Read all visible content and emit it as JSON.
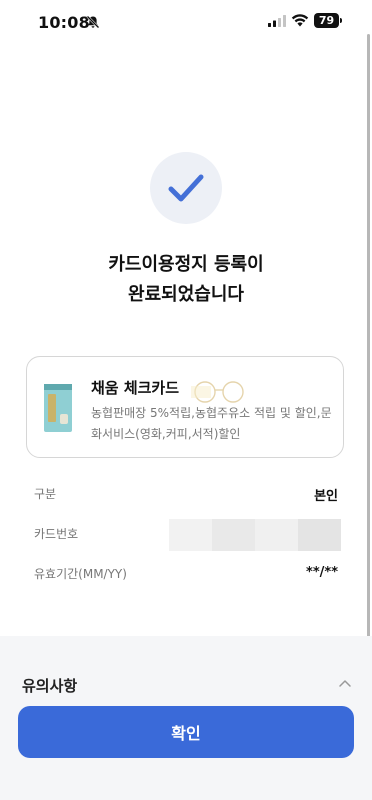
{
  "status_bar": {
    "time": "10:08",
    "battery": "79",
    "icons": [
      "bell-off-icon",
      "signal-icon",
      "wifi-icon",
      "battery-icon"
    ]
  },
  "result": {
    "icon": "check-icon",
    "title_line1": "카드이용정지 등록이",
    "title_line2": "완료되었습니다"
  },
  "card": {
    "name": "채움 체크카드",
    "description": "농협판매장 5%적립,농협주유소 적립 및 할인,문화서비스(영화,커피,서적)할인"
  },
  "info": {
    "type_label": "구분",
    "type_value": "본인",
    "card_number_label": "카드번호",
    "card_number_masked": [
      "#f2f2f2",
      "#e9e9e9",
      "#f0f0f0",
      "#e4e4e4"
    ],
    "expiry_label": "유효기간(MM/YY)",
    "expiry_value": "**/**"
  },
  "notice": {
    "label": "유의사항",
    "icon": "chevron-up-icon"
  },
  "confirm_button": {
    "label": "확인"
  },
  "colors": {
    "primary": "#3a6ad9",
    "check": "#4470d7",
    "check_bg": "#edf0f6",
    "bottom_bg": "#f5f6f8"
  }
}
